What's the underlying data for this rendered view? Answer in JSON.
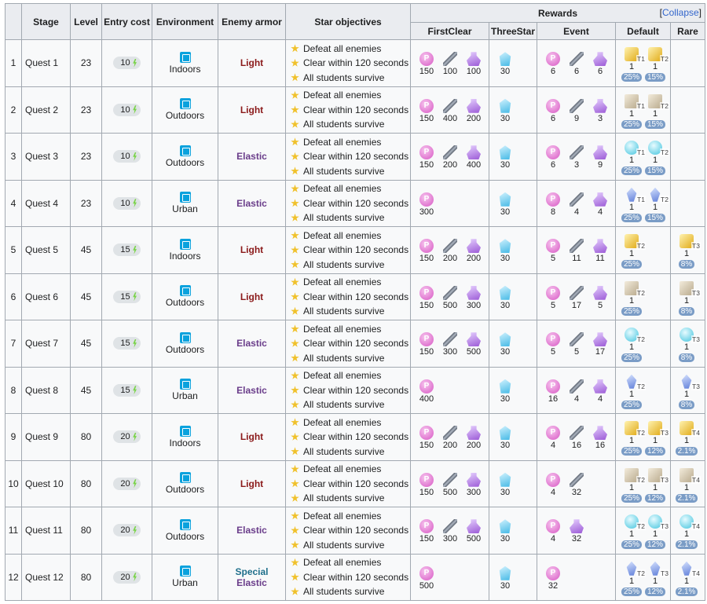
{
  "headers": {
    "stage": "Stage",
    "level": "Level",
    "entry_cost": "Entry cost",
    "environment": "Environment",
    "enemy_armor": "Enemy armor",
    "star_objectives": "Star objectives",
    "rewards": "Rewards",
    "collapse": "Collapse",
    "first_clear": "FirstClear",
    "three_star": "ThreeStar",
    "event": "Event",
    "default": "Default",
    "rare": "Rare"
  },
  "objectives": [
    "Defeat all enemies",
    "Clear within 120 seconds",
    "All students survive"
  ],
  "rows": [
    {
      "num": "1",
      "stage": "Quest 1",
      "level": "23",
      "cost": "10",
      "env": "Indoors",
      "armor": "Light",
      "armor2": "",
      "first": [
        [
          "pyroxene",
          "150"
        ],
        [
          "rod",
          "100"
        ],
        [
          "potion",
          "100"
        ]
      ],
      "three": [
        [
          "crystal",
          "30"
        ]
      ],
      "event": [
        [
          "pyroxene",
          "6"
        ],
        [
          "rod",
          "6"
        ],
        [
          "potion",
          "6"
        ]
      ],
      "default": [
        [
          "oopart",
          "1",
          "T1",
          "25%"
        ],
        [
          "oopart",
          "1",
          "T2",
          "15%"
        ]
      ],
      "rare": []
    },
    {
      "num": "2",
      "stage": "Quest 2",
      "level": "23",
      "cost": "10",
      "env": "Outdoors",
      "armor": "Light",
      "armor2": "",
      "first": [
        [
          "pyroxene",
          "150"
        ],
        [
          "rod",
          "400"
        ],
        [
          "potion",
          "200"
        ]
      ],
      "three": [
        [
          "crystal",
          "30"
        ]
      ],
      "event": [
        [
          "pyroxene",
          "6"
        ],
        [
          "rod",
          "9"
        ],
        [
          "potion",
          "3"
        ]
      ],
      "default": [
        [
          "note",
          "1",
          "T1",
          "25%"
        ],
        [
          "note",
          "1",
          "T2",
          "15%"
        ]
      ],
      "rare": []
    },
    {
      "num": "3",
      "stage": "Quest 3",
      "level": "23",
      "cost": "10",
      "env": "Outdoors",
      "armor": "Elastic",
      "armor2": "",
      "first": [
        [
          "pyroxene",
          "150"
        ],
        [
          "rod",
          "200"
        ],
        [
          "potion",
          "400"
        ]
      ],
      "three": [
        [
          "crystal",
          "30"
        ]
      ],
      "event": [
        [
          "pyroxene",
          "6"
        ],
        [
          "rod",
          "3"
        ],
        [
          "potion",
          "9"
        ]
      ],
      "default": [
        [
          "disc",
          "1",
          "T1",
          "25%"
        ],
        [
          "disc",
          "1",
          "T2",
          "15%"
        ]
      ],
      "rare": []
    },
    {
      "num": "4",
      "stage": "Quest 4",
      "level": "23",
      "cost": "10",
      "env": "Urban",
      "armor": "Elastic",
      "armor2": "",
      "first": [
        [
          "pyroxene",
          "300"
        ]
      ],
      "three": [
        [
          "crystal",
          "30"
        ]
      ],
      "event": [
        [
          "pyroxene",
          "8"
        ],
        [
          "rod",
          "4"
        ],
        [
          "potion",
          "4"
        ]
      ],
      "default": [
        [
          "blue",
          "1",
          "T1",
          "25%"
        ],
        [
          "blue",
          "1",
          "T2",
          "15%"
        ]
      ],
      "rare": []
    },
    {
      "num": "5",
      "stage": "Quest 5",
      "level": "45",
      "cost": "15",
      "env": "Indoors",
      "armor": "Light",
      "armor2": "",
      "first": [
        [
          "pyroxene",
          "150"
        ],
        [
          "rod",
          "200"
        ],
        [
          "potion",
          "200"
        ]
      ],
      "three": [
        [
          "crystal",
          "30"
        ]
      ],
      "event": [
        [
          "pyroxene",
          "5"
        ],
        [
          "rod",
          "11"
        ],
        [
          "potion",
          "11"
        ]
      ],
      "default": [
        [
          "oopart",
          "1",
          "T2",
          "25%"
        ]
      ],
      "rare": [
        [
          "oopart",
          "1",
          "T3",
          "8%"
        ]
      ]
    },
    {
      "num": "6",
      "stage": "Quest 6",
      "level": "45",
      "cost": "15",
      "env": "Outdoors",
      "armor": "Light",
      "armor2": "",
      "first": [
        [
          "pyroxene",
          "150"
        ],
        [
          "rod",
          "500"
        ],
        [
          "potion",
          "300"
        ]
      ],
      "three": [
        [
          "crystal",
          "30"
        ]
      ],
      "event": [
        [
          "pyroxene",
          "5"
        ],
        [
          "rod",
          "17"
        ],
        [
          "potion",
          "5"
        ]
      ],
      "default": [
        [
          "note",
          "1",
          "T2",
          "25%"
        ]
      ],
      "rare": [
        [
          "note",
          "1",
          "T3",
          "8%"
        ]
      ]
    },
    {
      "num": "7",
      "stage": "Quest 7",
      "level": "45",
      "cost": "15",
      "env": "Outdoors",
      "armor": "Elastic",
      "armor2": "",
      "first": [
        [
          "pyroxene",
          "150"
        ],
        [
          "rod",
          "300"
        ],
        [
          "potion",
          "500"
        ]
      ],
      "three": [
        [
          "crystal",
          "30"
        ]
      ],
      "event": [
        [
          "pyroxene",
          "5"
        ],
        [
          "rod",
          "5"
        ],
        [
          "potion",
          "17"
        ]
      ],
      "default": [
        [
          "disc",
          "1",
          "T2",
          "25%"
        ]
      ],
      "rare": [
        [
          "disc",
          "1",
          "T3",
          "8%"
        ]
      ]
    },
    {
      "num": "8",
      "stage": "Quest 8",
      "level": "45",
      "cost": "15",
      "env": "Urban",
      "armor": "Elastic",
      "armor2": "",
      "first": [
        [
          "pyroxene",
          "400"
        ]
      ],
      "three": [
        [
          "crystal",
          "30"
        ]
      ],
      "event": [
        [
          "pyroxene",
          "16"
        ],
        [
          "rod",
          "4"
        ],
        [
          "potion",
          "4"
        ]
      ],
      "default": [
        [
          "blue",
          "1",
          "T2",
          "25%"
        ]
      ],
      "rare": [
        [
          "blue",
          "1",
          "T3",
          "8%"
        ]
      ]
    },
    {
      "num": "9",
      "stage": "Quest 9",
      "level": "80",
      "cost": "20",
      "env": "Indoors",
      "armor": "Light",
      "armor2": "",
      "first": [
        [
          "pyroxene",
          "150"
        ],
        [
          "rod",
          "200"
        ],
        [
          "potion",
          "200"
        ]
      ],
      "three": [
        [
          "crystal",
          "30"
        ]
      ],
      "event": [
        [
          "pyroxene",
          "4"
        ],
        [
          "rod",
          "16"
        ],
        [
          "potion",
          "16"
        ]
      ],
      "default": [
        [
          "oopart",
          "1",
          "T2",
          "25%"
        ],
        [
          "oopart",
          "1",
          "T3",
          "12%"
        ]
      ],
      "rare": [
        [
          "oopart",
          "1",
          "T4",
          "2.1%"
        ]
      ]
    },
    {
      "num": "10",
      "stage": "Quest 10",
      "level": "80",
      "cost": "20",
      "env": "Outdoors",
      "armor": "Light",
      "armor2": "",
      "first": [
        [
          "pyroxene",
          "150"
        ],
        [
          "rod",
          "500"
        ],
        [
          "potion",
          "300"
        ]
      ],
      "three": [
        [
          "crystal",
          "30"
        ]
      ],
      "event": [
        [
          "pyroxene",
          "4"
        ],
        [
          "rod",
          "32"
        ]
      ],
      "default": [
        [
          "note",
          "1",
          "T2",
          "25%"
        ],
        [
          "note",
          "1",
          "T3",
          "12%"
        ]
      ],
      "rare": [
        [
          "note",
          "1",
          "T4",
          "2.1%"
        ]
      ]
    },
    {
      "num": "11",
      "stage": "Quest 11",
      "level": "80",
      "cost": "20",
      "env": "Outdoors",
      "armor": "Elastic",
      "armor2": "",
      "first": [
        [
          "pyroxene",
          "150"
        ],
        [
          "rod",
          "300"
        ],
        [
          "potion",
          "500"
        ]
      ],
      "three": [
        [
          "crystal",
          "30"
        ]
      ],
      "event": [
        [
          "pyroxene",
          "4"
        ],
        [
          "potion",
          "32"
        ]
      ],
      "default": [
        [
          "disc",
          "1",
          "T2",
          "25%"
        ],
        [
          "disc",
          "1",
          "T3",
          "12%"
        ]
      ],
      "rare": [
        [
          "disc",
          "1",
          "T4",
          "2.1%"
        ]
      ]
    },
    {
      "num": "12",
      "stage": "Quest 12",
      "level": "80",
      "cost": "20",
      "env": "Urban",
      "armor": "Special",
      "armor2": "Elastic",
      "first": [
        [
          "pyroxene",
          "500"
        ]
      ],
      "three": [
        [
          "crystal",
          "30"
        ]
      ],
      "event": [
        [
          "pyroxene",
          "32"
        ]
      ],
      "default": [
        [
          "blue",
          "1",
          "T2",
          "25%"
        ],
        [
          "blue",
          "1",
          "T3",
          "12%"
        ]
      ],
      "rare": [
        [
          "blue",
          "1",
          "T4",
          "2.1%"
        ]
      ]
    }
  ]
}
